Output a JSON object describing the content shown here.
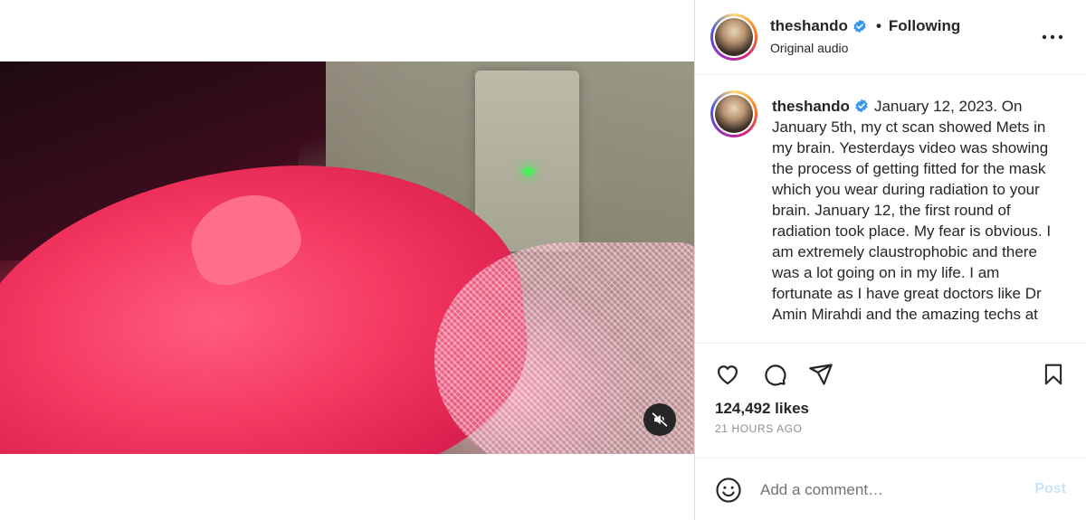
{
  "post": {
    "username": "theshando",
    "follow_status": "Following",
    "dot": "•",
    "audio": "Original audio",
    "caption": "January 12, 2023. On January 5th, my ct scan showed Mets in my brain. Yesterdays video was showing the process of getting fitted for the mask which you wear during radiation to your brain. January 12, the first round of radiation took place. My fear is obvious. I am extremely claustrophobic and there was a lot going on in my life. I am fortunate as I have great doctors like Dr Amin Mirahdi and the amazing techs at",
    "likes": "124,492 likes",
    "time_ago": "21 HOURS AGO"
  },
  "comment": {
    "placeholder": "Add a comment…",
    "post_label": "Post"
  },
  "icons": {
    "verified": "verified-badge-icon",
    "more": "more-options-icon",
    "mute": "speaker-muted-icon",
    "like": "heart-icon",
    "comment": "comment-bubble-icon",
    "share": "paper-plane-icon",
    "save": "bookmark-icon",
    "emoji": "emoji-smile-icon"
  },
  "colors": {
    "verified_blue": "#3897f0",
    "post_button_disabled": "#c7e3fb",
    "muted_text": "#8e8e8e"
  }
}
